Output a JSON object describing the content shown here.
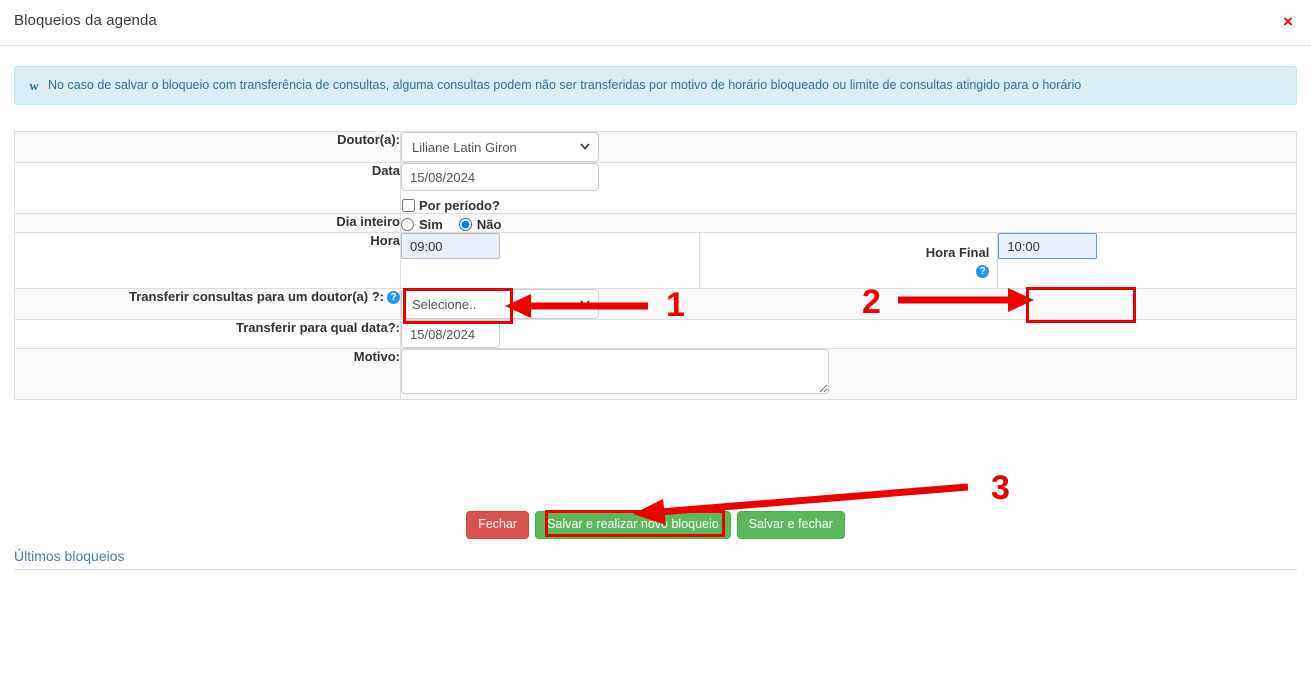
{
  "modal": {
    "title": "Bloqueios da agenda",
    "close_icon": "close-icon",
    "close_label": "×"
  },
  "alert": {
    "icon": "info-icon",
    "icon_glyph": "ℹ",
    "text": "No caso de salvar o bloqueio com transferência de consultas, alguma consultas podem não ser transferidas por motivo de horário bloqueado ou limite de consultas atingido para o horário"
  },
  "form": {
    "doctor": {
      "label": "Doutor(a):",
      "value": "Liliane Latin Giron",
      "options": [
        "Liliane Latin Giron"
      ]
    },
    "date": {
      "label": "Data",
      "value": "15/08/2024",
      "by_period_label": "Por período?",
      "by_period_checked": false
    },
    "all_day": {
      "label": "Dia inteiro",
      "options": [
        "Sim",
        "Não"
      ],
      "selected": "Não"
    },
    "hora": {
      "label": "Hora",
      "value": "09:00"
    },
    "hora_final": {
      "label": "Hora Final",
      "value": "10:00",
      "help_glyph": "?"
    },
    "transfer_doctor": {
      "label": "Transferir consultas para um doutor(a) ?:",
      "help_glyph": "?",
      "value": "Selecione..",
      "options": [
        "Selecione.."
      ]
    },
    "transfer_date": {
      "label": "Transferir para qual data?:",
      "value": "15/08/2024"
    },
    "reason": {
      "label": "Motivo:",
      "value": "",
      "placeholder": ""
    }
  },
  "buttons": {
    "close": "Fechar",
    "save_new": "Salvar e realizar novo bloqueio",
    "save_close": "Salvar e fechar"
  },
  "section": {
    "last_blocks_title": "Últimos bloqueios"
  },
  "annotations": {
    "step1": "1",
    "step2": "2",
    "step3": "3"
  },
  "colors": {
    "accent_blue": "#2196f3",
    "alert_bg": "#d9edf7",
    "alert_text": "#31708f",
    "danger": "#d9534f",
    "success": "#5cb85c",
    "annotation_red": "#ee0000"
  }
}
